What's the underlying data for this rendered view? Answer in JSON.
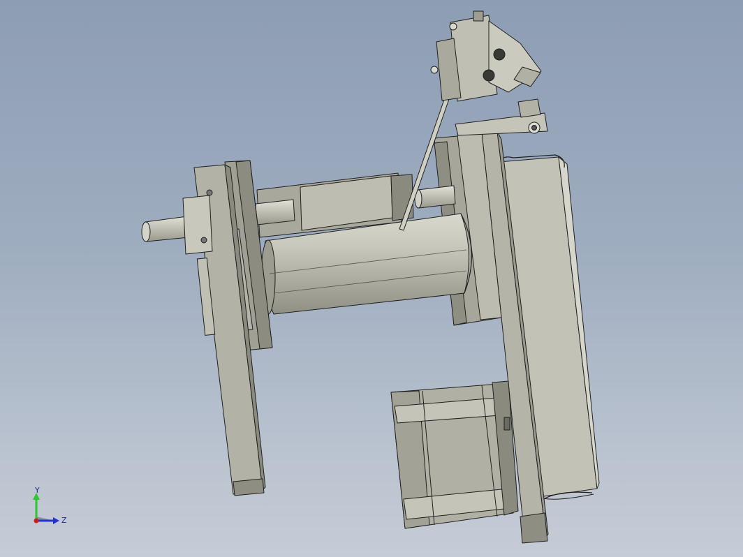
{
  "viewport": {
    "background_top": "#8d9db4",
    "background_bottom": "#c6ccd6",
    "part_color": "#b8b8ac",
    "edge_color": "#1f1f1f"
  },
  "triad": {
    "y_label": "Y",
    "z_label": "Z",
    "y_color": "#2ec52e",
    "z_color": "#2233cc",
    "origin_color": "#d01c1c"
  }
}
